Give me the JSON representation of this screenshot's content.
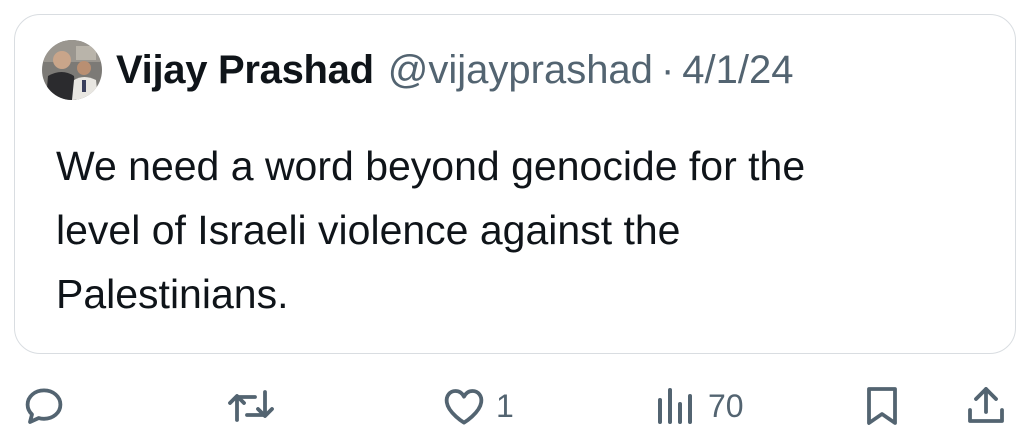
{
  "quote": {
    "author_name": "Vijay Prashad",
    "handle": "@vijayprashad",
    "separator": "·",
    "date": "4/1/24",
    "text": "We need a word beyond genocide for the\nlevel of Israeli violence against the\nPalestinians."
  },
  "actions": {
    "reply": {
      "icon": "reply-icon"
    },
    "retweet": {
      "icon": "retweet-icon"
    },
    "like": {
      "icon": "heart-icon",
      "count": "1"
    },
    "views": {
      "icon": "views-chart-icon",
      "count": "70"
    },
    "bookmark": {
      "icon": "bookmark-icon"
    },
    "share": {
      "icon": "share-icon"
    }
  },
  "colors": {
    "text": "#0f1419",
    "secondary": "#536471",
    "border": "#d9dde1"
  }
}
